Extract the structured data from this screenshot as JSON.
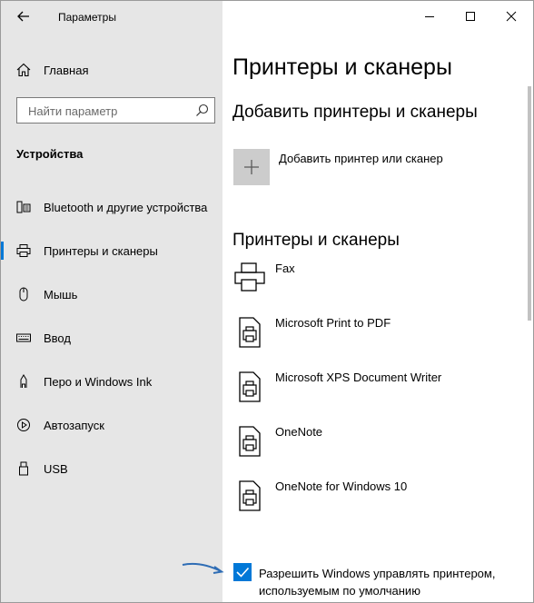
{
  "window": {
    "title": "Параметры",
    "accent": "#0078d7",
    "controls": {
      "minimize": "minimize-icon",
      "maximize": "maximize-icon",
      "close": "close-icon"
    }
  },
  "sidebar": {
    "home_label": "Главная",
    "search_placeholder": "Найти параметр",
    "section_title": "Устройства",
    "items": [
      {
        "label": "Bluetooth и другие устройства",
        "icon": "bluetooth-devices-icon",
        "selected": false
      },
      {
        "label": "Принтеры и сканеры",
        "icon": "printer-icon",
        "selected": true
      },
      {
        "label": "Мышь",
        "icon": "mouse-icon",
        "selected": false
      },
      {
        "label": "Ввод",
        "icon": "keyboard-icon",
        "selected": false
      },
      {
        "label": "Перо и Windows Ink",
        "icon": "pen-icon",
        "selected": false
      },
      {
        "label": "Автозапуск",
        "icon": "autoplay-icon",
        "selected": false
      },
      {
        "label": "USB",
        "icon": "usb-icon",
        "selected": false
      }
    ]
  },
  "main": {
    "page_title": "Принтеры и сканеры",
    "add_section_title": "Добавить принтеры и сканеры",
    "add_button_label": "Добавить принтер или сканер",
    "list_section_title": "Принтеры и сканеры",
    "printers": [
      {
        "name": "Fax",
        "icon": "fax-icon"
      },
      {
        "name": "Microsoft Print to PDF",
        "icon": "document-printer-icon"
      },
      {
        "name": "Microsoft XPS Document Writer",
        "icon": "document-printer-icon"
      },
      {
        "name": "OneNote",
        "icon": "document-printer-icon"
      },
      {
        "name": "OneNote for Windows 10",
        "icon": "document-printer-icon"
      }
    ],
    "default_printer_checkbox": {
      "checked": true,
      "label_line1": "Разрешить Windows управлять принтером,",
      "label_line2": "используемым по умолчанию"
    }
  }
}
